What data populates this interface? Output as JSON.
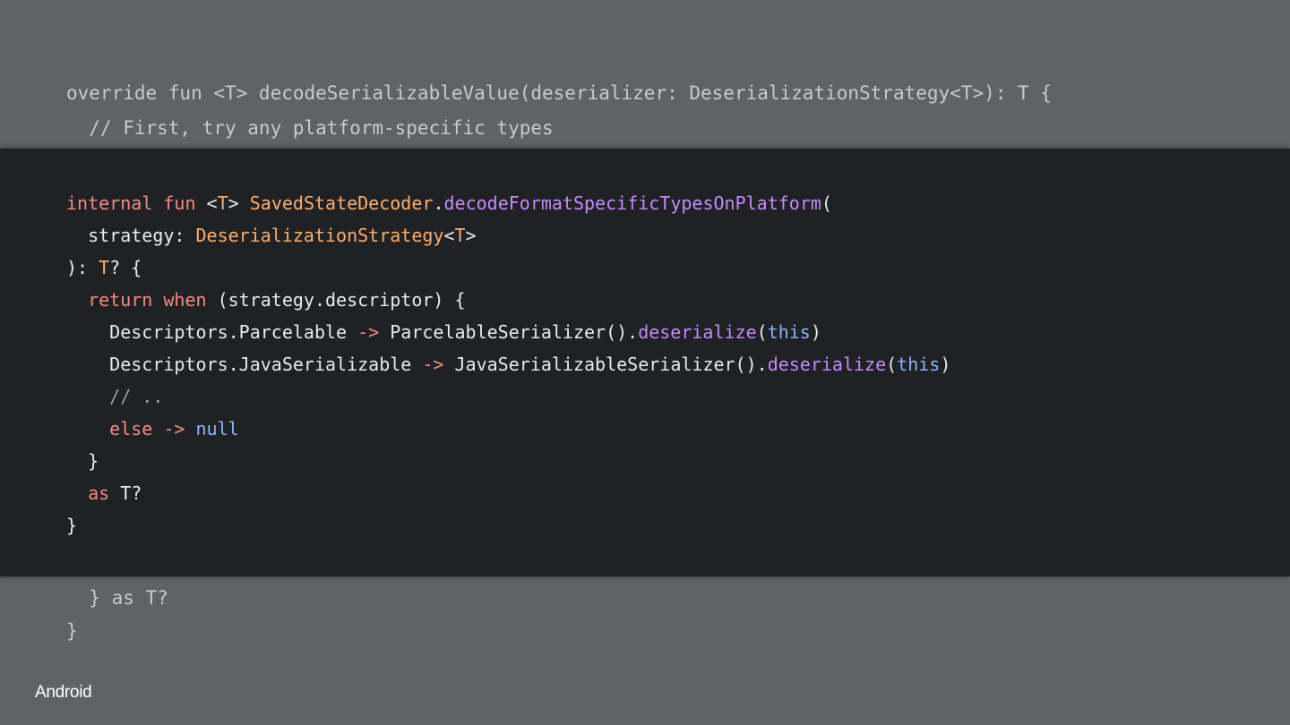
{
  "colors": {
    "background": "#5f6368",
    "panel": "#202124",
    "keyword": "#f28b82",
    "type": "#fcad70",
    "function": "#c58af9",
    "literal": "#8ab4f8",
    "plain": "#e8eaed",
    "comment": "#9aa0a6",
    "dimmed": "#c7c9cc"
  },
  "background_code": {
    "line_1": "override fun <T> decodeSerializableValue(deserializer: DeserializationStrategy<T>): T {",
    "line_2": "  // First, try any platform-specific types",
    "line_3": "  } as T?",
    "line_4": "}"
  },
  "code": [
    [
      {
        "text": "internal fun ",
        "kind": "keyword"
      },
      {
        "text": "<",
        "kind": "plain"
      },
      {
        "text": "T",
        "kind": "type"
      },
      {
        "text": "> ",
        "kind": "plain"
      },
      {
        "text": "SavedStateDecoder",
        "kind": "type"
      },
      {
        "text": ".",
        "kind": "plain"
      },
      {
        "text": "decodeFormatSpecificTypesOnPlatform",
        "kind": "function"
      },
      {
        "text": "(",
        "kind": "plain"
      }
    ],
    [
      {
        "text": "  strategy: ",
        "kind": "plain"
      },
      {
        "text": "DeserializationStrategy",
        "kind": "type"
      },
      {
        "text": "<",
        "kind": "plain"
      },
      {
        "text": "T",
        "kind": "type"
      },
      {
        "text": ">",
        "kind": "plain"
      }
    ],
    [
      {
        "text": "): ",
        "kind": "plain"
      },
      {
        "text": "T",
        "kind": "type"
      },
      {
        "text": "? {",
        "kind": "plain"
      }
    ],
    [
      {
        "text": "  return when ",
        "kind": "keyword"
      },
      {
        "text": "(strategy.descriptor) {",
        "kind": "plain"
      }
    ],
    [
      {
        "text": "    Descriptors.Parcelable ",
        "kind": "plain"
      },
      {
        "text": "->",
        "kind": "keyword"
      },
      {
        "text": " ParcelableSerializer().",
        "kind": "plain"
      },
      {
        "text": "deserialize",
        "kind": "function"
      },
      {
        "text": "(",
        "kind": "plain"
      },
      {
        "text": "this",
        "kind": "literal"
      },
      {
        "text": ")",
        "kind": "plain"
      }
    ],
    [
      {
        "text": "    Descriptors.JavaSerializable ",
        "kind": "plain"
      },
      {
        "text": "->",
        "kind": "keyword"
      },
      {
        "text": " JavaSerializableSerializer().",
        "kind": "plain"
      },
      {
        "text": "deserialize",
        "kind": "function"
      },
      {
        "text": "(",
        "kind": "plain"
      },
      {
        "text": "this",
        "kind": "literal"
      },
      {
        "text": ")",
        "kind": "plain"
      }
    ],
    [
      {
        "text": "    // ..",
        "kind": "comment"
      }
    ],
    [
      {
        "text": "    else -> ",
        "kind": "keyword"
      },
      {
        "text": "null",
        "kind": "literal"
      }
    ],
    [
      {
        "text": "  }",
        "kind": "plain"
      }
    ],
    [
      {
        "text": "  as ",
        "kind": "keyword"
      },
      {
        "text": "T?",
        "kind": "plain"
      }
    ],
    [
      {
        "text": "}",
        "kind": "plain"
      }
    ]
  ],
  "logo": {
    "text": "Android"
  }
}
